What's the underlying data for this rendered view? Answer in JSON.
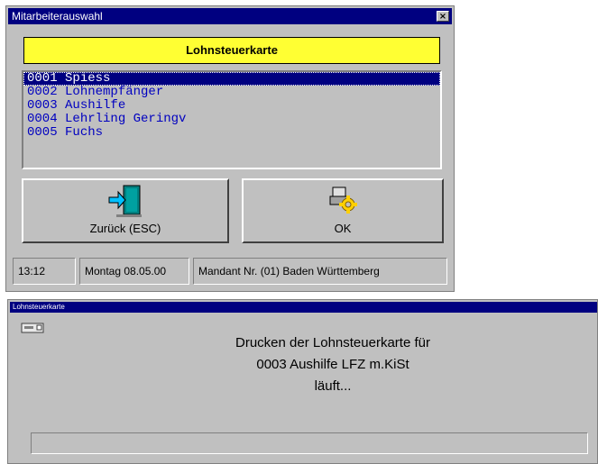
{
  "dialog": {
    "title": "Mitarbeiterauswahl",
    "close_glyph": "×",
    "banner": "Lohnsteuerkarte",
    "employees": [
      {
        "id": "0001",
        "name": "Spiess",
        "selected": true
      },
      {
        "id": "0002",
        "name": "Lohnempfänger",
        "selected": false
      },
      {
        "id": "0003",
        "name": "Aushilfe",
        "selected": false
      },
      {
        "id": "0004",
        "name": "Lehrling Geringv",
        "selected": false
      },
      {
        "id": "0005",
        "name": "Fuchs",
        "selected": false
      }
    ],
    "back_button": {
      "label": "Zurück (ESC)",
      "icon": "exit-door-icon"
    },
    "ok_button": {
      "label": "OK",
      "icon": "printer-gear-icon"
    },
    "status": {
      "time": "13:12",
      "date": "Montag  08.05.00",
      "mandant": "Mandant Nr. (01)  Baden Württemberg"
    }
  },
  "print_window": {
    "title": "Lohnsteuerkarte",
    "line1": "Drucken der Lohnsteuerkarte für",
    "line2": "0003 Aushilfe LFZ m.KiSt",
    "line3": "läuft...",
    "icon": "printer-icon",
    "progress": 0
  },
  "colors": {
    "titlebar": "#000080",
    "banner": "#ffff33",
    "list_text": "#0000c0",
    "window": "#c0c0c0"
  }
}
